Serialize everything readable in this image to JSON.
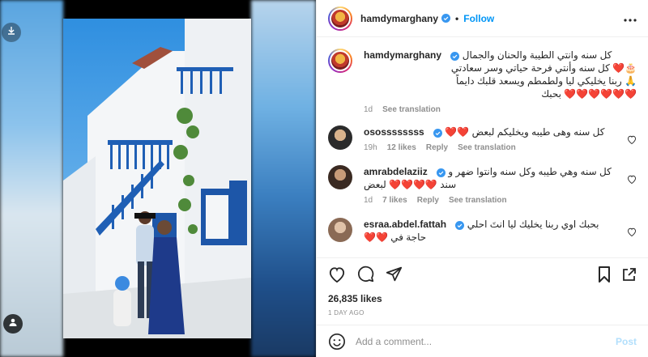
{
  "post": {
    "username": "hamdymarghany",
    "follow_label": "Follow",
    "separator": "•",
    "likes": "26,835 likes",
    "time_label": "1 DAY AGO",
    "comment_placeholder": "Add a comment...",
    "post_label": "Post"
  },
  "caption": {
    "username": "hamdymarghany",
    "lines": [
      "كل سنه وانتي الطيبة والحنان والجمال",
      "🎂❤️ كل سنه وأنتي فرحة حياتي وسر سعادتي",
      "🙏 ربنا يخليكي ليا ولطمطم ويسعد قلبك دايماً",
      "❤️❤️❤️❤️❤️❤️ بحبك"
    ],
    "time": "1d",
    "see_translation": "See translation"
  },
  "comments": [
    {
      "username": "osossssssss",
      "verified": true,
      "text": "كل سنه وهى طيبه ويخليكم لبعض ❤️❤️",
      "time": "19h",
      "likes": "12 likes",
      "reply": "Reply",
      "see_translation": "See translation"
    },
    {
      "username": "amrabdelaziiz",
      "verified": true,
      "text": "كل سنه وهي طيبه وكل سنه وانتوا ضهر و سند ❤️❤️❤️❤️ لبعض",
      "time": "1d",
      "likes": "7 likes",
      "reply": "Reply",
      "see_translation": "See translation"
    },
    {
      "username": "esraa.abdel.fattah",
      "verified": true,
      "text": "بحبك اوي ربنا يخليك ليا انتَ احلي حاجة في ❤️❤️",
      "time": "",
      "likes": "",
      "reply": "",
      "see_translation": ""
    }
  ],
  "icons": {
    "like": "heart-outline-icon",
    "comment": "comment-bubble-icon",
    "share": "paper-plane-icon",
    "save": "bookmark-icon",
    "more": "ellipsis-icon",
    "emoji": "smiley-icon",
    "verified": "verified-badge-icon",
    "download": "download-icon",
    "user_tag": "user-tag-icon"
  },
  "colors": {
    "accent": "#0095f6",
    "post_disabled": "#b2dffc",
    "verified": "#3897f0",
    "heart": "#ed4956",
    "muted": "#8e8e8e"
  }
}
